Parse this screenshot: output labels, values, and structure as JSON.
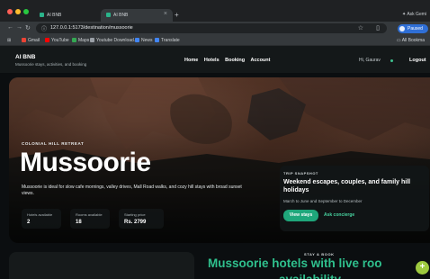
{
  "browser": {
    "tabs": [
      {
        "title": "AI BNB",
        "active": false
      },
      {
        "title": "AI BNB",
        "active": true
      }
    ],
    "new_tab": "+",
    "ask_gemini": "Ask Gemi",
    "url": "127.0.0.1:5173/destination/mussoorie",
    "profile_label": "Paused",
    "bookmarks": [
      {
        "label": "Gmail",
        "icon": "gmail-icon",
        "color": "#ea4335"
      },
      {
        "label": "YouTube",
        "icon": "youtube-icon",
        "color": "#ff0000"
      },
      {
        "label": "Maps",
        "icon": "maps-icon",
        "color": "#34a853"
      },
      {
        "label": "Youtube Download...",
        "icon": "download-icon",
        "color": "#9aa0a6"
      },
      {
        "label": "News",
        "icon": "news-icon",
        "color": "#4285f4"
      },
      {
        "label": "Translate",
        "icon": "translate-icon",
        "color": "#4285f4"
      }
    ],
    "all_bookmarks": "All Bookma"
  },
  "header": {
    "brand": "AI BNB",
    "tagline": "Mussoorie stays, activities, and booking",
    "nav": [
      "Home",
      "Hotels",
      "Booking",
      "Account"
    ],
    "greeting": "Hi, Gaurav",
    "logout": "Logout"
  },
  "hero": {
    "eyebrow": "COLONIAL HILL RETREAT",
    "title": "Mussoorie",
    "description": "Mussoorie is ideal for slow cafe mornings, valley drives, Mall Road walks, and cozy hill stays with broad sunset views.",
    "stats": [
      {
        "label": "Hotels available",
        "value": "2"
      },
      {
        "label": "Rooms available",
        "value": "18"
      },
      {
        "label": "Starting price",
        "value": "Rs. 2799"
      }
    ]
  },
  "snapshot": {
    "eyebrow": "TRIP SNAPSHOT",
    "title": "Weekend escapes, couples, and family hill holidays",
    "subtitle": "March to June and September to December",
    "view_stays": "View stays",
    "ask_concierge": "Ask concierge"
  },
  "stay_section": {
    "eyebrow": "STAY & BOOK",
    "title_line1": "Mussoorie hotels with live roo",
    "title_line2": "availability"
  },
  "fab_icon": "plus-icon"
}
